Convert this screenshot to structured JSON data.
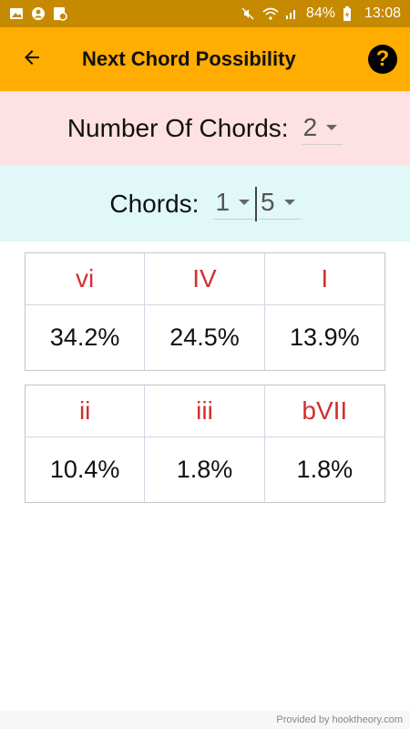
{
  "status_bar": {
    "battery": "84%",
    "time": "13:08",
    "icons_left": [
      "image-icon",
      "account-icon",
      "lock-icon"
    ],
    "icons_right": [
      "mute-icon",
      "wifi-icon",
      "signal-icon",
      "battery-icon"
    ]
  },
  "app_bar": {
    "title": "Next Chord Possibility",
    "back_icon": "arrow-left-icon",
    "help_icon": "help-icon",
    "help_glyph": "?"
  },
  "num_chords": {
    "label": "Number Of Chords:",
    "value": "2"
  },
  "chords": {
    "label": "Chords:",
    "first": "1",
    "second": "5"
  },
  "results": [
    {
      "chord": "vi",
      "percent": "34.2%"
    },
    {
      "chord": "IV",
      "percent": "24.5%"
    },
    {
      "chord": "I",
      "percent": "13.9%"
    },
    {
      "chord": "ii",
      "percent": "10.4%"
    },
    {
      "chord": "iii",
      "percent": "1.8%"
    },
    {
      "chord": "bVII",
      "percent": "1.8%"
    }
  ],
  "footer": {
    "text": "Provided by hooktheory.com"
  },
  "colors": {
    "app_bar": "#ffad00",
    "status_bar": "#c68a00",
    "num_section_bg": "#fde1e3",
    "chords_section_bg": "#e0f8f8",
    "chord_text": "#d32f2f"
  }
}
